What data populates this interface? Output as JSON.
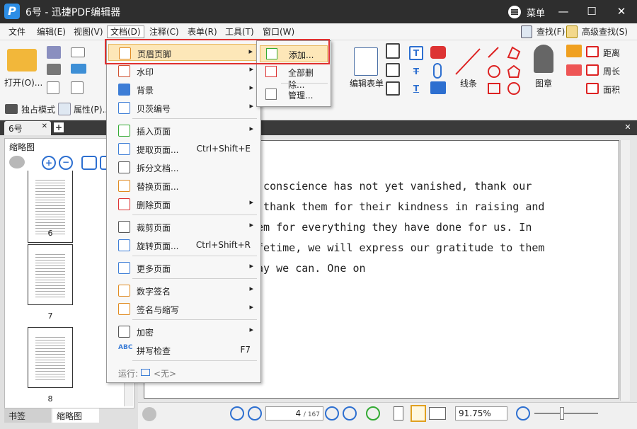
{
  "window": {
    "title": "6号 - 迅捷PDF编辑器",
    "menu_label": "菜单",
    "min": "—",
    "max": "☐",
    "close": "✕"
  },
  "menubar": {
    "items": [
      "文件",
      "编辑(E)",
      "视图(V)",
      "文档(D)",
      "注释(C)",
      "表单(R)",
      "工具(T)",
      "窗口(W)"
    ],
    "find": "查找(F)",
    "adv_find": "高级查找(S)"
  },
  "ribbon": {
    "open": "打开(O)...",
    "solo_mode": "独占模式",
    "properties": "属性(P)...",
    "edit_form": "编辑表单",
    "lines": "线条",
    "stamp": "图章",
    "distance": "距离",
    "perimeter": "周长",
    "area": "面积"
  },
  "tabs": {
    "doc": "6号"
  },
  "sidebar": {
    "title": "缩略图",
    "pages": [
      "6",
      "7",
      "8"
    ],
    "tab_bookmarks": "书签",
    "tab_thumbs": "缩略图"
  },
  "document": {
    "lines": [
      "r conscience has not yet vanished, thank our",
      ", thank them for their kindness in raising and",
      "hem for everything they have done for us. In",
      "ifetime, we will express our gratitude to them",
      "way we can. One on"
    ]
  },
  "status": {
    "page_current": "4",
    "page_total": "/ 167",
    "zoom": "91.75%"
  },
  "doc_menu": {
    "items": [
      {
        "label": "页眉页脚",
        "shortcut": "",
        "arrow": "▸"
      },
      {
        "label": "水印",
        "shortcut": "",
        "arrow": "▸"
      },
      {
        "label": "背景",
        "shortcut": "",
        "arrow": "▸"
      },
      {
        "label": "贝茨编号",
        "shortcut": "",
        "arrow": "▸"
      },
      {
        "label": "插入页面",
        "shortcut": "",
        "arrow": "▸"
      },
      {
        "label": "提取页面...",
        "shortcut": "Ctrl+Shift+E",
        "arrow": ""
      },
      {
        "label": "拆分文档...",
        "shortcut": "",
        "arrow": ""
      },
      {
        "label": "替换页面...",
        "shortcut": "",
        "arrow": ""
      },
      {
        "label": "删除页面",
        "shortcut": "",
        "arrow": "▸"
      },
      {
        "label": "裁剪页面",
        "shortcut": "",
        "arrow": "▸"
      },
      {
        "label": "旋转页面...",
        "shortcut": "Ctrl+Shift+R",
        "arrow": ""
      },
      {
        "label": "更多页面",
        "shortcut": "",
        "arrow": "▸"
      },
      {
        "label": "数字签名",
        "shortcut": "",
        "arrow": "▸"
      },
      {
        "label": "签名与缩写",
        "shortcut": "",
        "arrow": "▸"
      },
      {
        "label": "加密",
        "shortcut": "",
        "arrow": "▸"
      },
      {
        "label": "拼写检查",
        "shortcut": "F7",
        "arrow": ""
      }
    ],
    "run_label": "运行:",
    "run_value": "<无>"
  },
  "submenu": {
    "items": [
      "添加...",
      "全部删除...",
      "管理..."
    ]
  }
}
